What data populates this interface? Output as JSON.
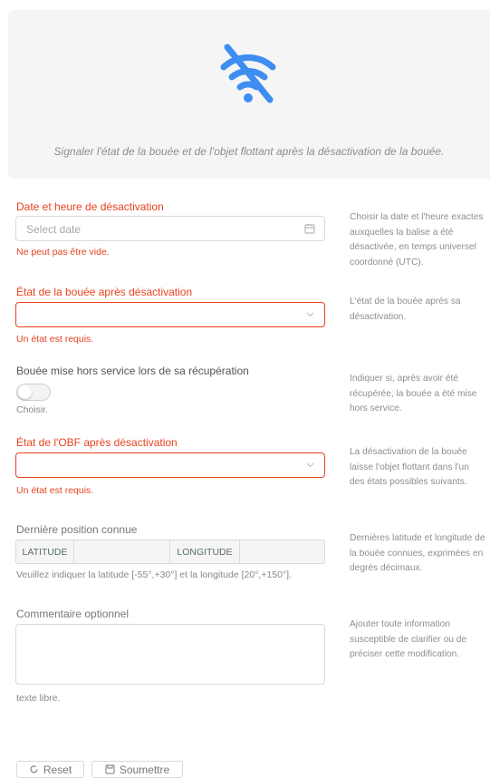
{
  "banner": {
    "message": "Signaler l'état de la bouée et de l'objet flottant après la désactivation de la bouée.",
    "icon": "wifi-off-icon",
    "icon_color": "#3d8ef0"
  },
  "date_field": {
    "label": "Date et heure de désactivation",
    "placeholder": "Select date",
    "error": "Ne peut pas être vide.",
    "help": "Choisir la date et l'heure exactes auxquelles la balise a été désactivée, en temps universel coordonné (UTC)."
  },
  "buoy_state": {
    "label": "État de la bouée après désactivation",
    "value": "",
    "error": "Un état est requis.",
    "help": "L'état de la bouée après sa désactivation."
  },
  "decommissioned": {
    "label": "Bouée mise hors service lors de sa récupération",
    "checked": false,
    "hint": "Choisir.",
    "help": "Indiquer si, après avoir été récupérée, la bouée a été mise hors service."
  },
  "obf_state": {
    "label": "État de l'OBF après désactivation",
    "value": "",
    "error": "Un état est requis.",
    "help": "La désactivation de la bouée laisse l'objet flottant dans l'un des états possibles suivants."
  },
  "position": {
    "label": "Dernière position connue",
    "latitude_label": "LATITUDE",
    "longitude_label": "LONGITUDE",
    "latitude_value": "",
    "longitude_value": "",
    "hint": "Veuillez indiquer la latitude [-55°,+30°] et la longitude [20°,+150°].",
    "help": "Dernières latitude et longitude de la bouée connues, exprimées en degrés décimaux."
  },
  "comment": {
    "label": "Commentaire optionnel",
    "value": "",
    "hint": "texte libre.",
    "help": "Ajouter toute information susceptible de clarifier ou de préciser cette modification."
  },
  "actions": {
    "reset_label": "Reset",
    "submit_label": "Soumettre"
  },
  "colors": {
    "error": "#e8421f",
    "accent": "#3d8ef0"
  }
}
